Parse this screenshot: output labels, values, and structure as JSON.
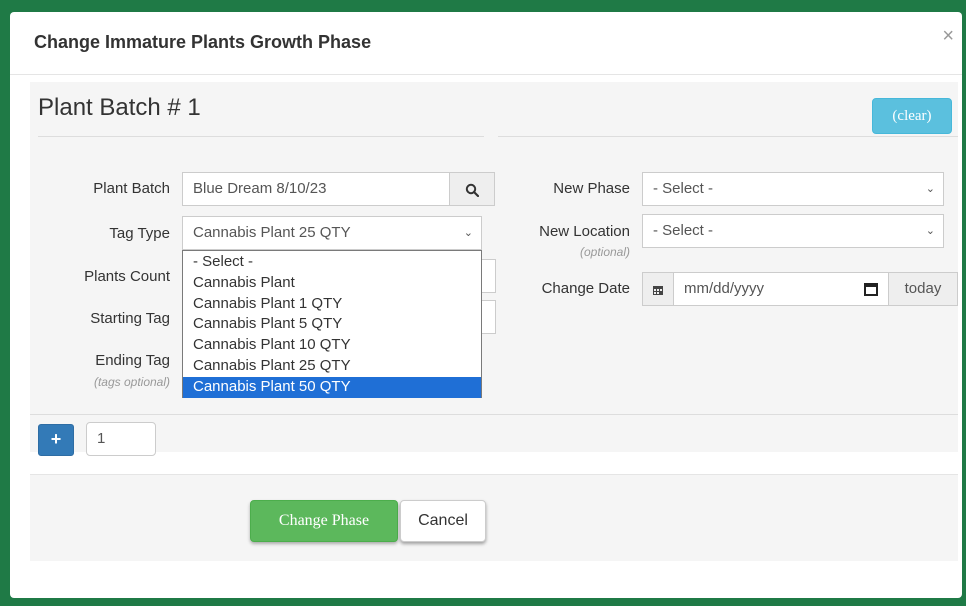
{
  "modal": {
    "title": "Change Immature Plants Growth Phase",
    "close": "×"
  },
  "batch": {
    "heading": "Plant Batch # 1",
    "clear_label": "(clear)"
  },
  "left": {
    "plant_batch_label": "Plant Batch",
    "plant_batch_value": "Blue Dream 8/10/23",
    "tag_type_label": "Tag Type",
    "tag_type_value": "Cannabis Plant 25 QTY",
    "plants_count_label": "Plants Count",
    "starting_tag_label": "Starting Tag",
    "ending_tag_label": "Ending Tag",
    "tags_optional": "(tags optional)"
  },
  "dropdown": {
    "options": [
      "- Select -",
      "Cannabis Plant",
      "Cannabis Plant 1 QTY",
      "Cannabis Plant 5 QTY",
      "Cannabis Plant 10 QTY",
      "Cannabis Plant 25 QTY",
      "Cannabis Plant 50 QTY"
    ],
    "highlighted": "Cannabis Plant 50 QTY"
  },
  "right": {
    "new_phase_label": "New Phase",
    "new_phase_value": "- Select -",
    "new_location_label": "New Location",
    "optional": "(optional)",
    "new_location_value": "- Select -",
    "change_date_label": "Change Date",
    "date_placeholder": "mm/dd/yyyy",
    "today_label": "today"
  },
  "add": {
    "plus": "+",
    "count": "1"
  },
  "footer": {
    "change_phase_label": "Change Phase",
    "cancel_label": "Cancel"
  }
}
